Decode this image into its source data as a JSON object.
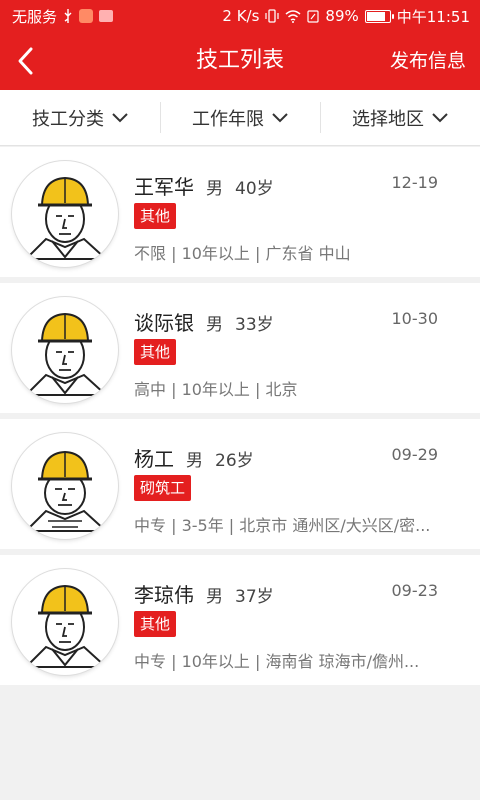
{
  "status_bar": {
    "carrier": "无服务",
    "speed": "2 K/s",
    "battery": "89%",
    "battery_level": 0.89,
    "time": "中午11:51"
  },
  "header": {
    "title": "技工列表",
    "action_label": "发布信息"
  },
  "filters": [
    {
      "label": "技工分类"
    },
    {
      "label": "工作年限"
    },
    {
      "label": "选择地区"
    }
  ],
  "workers": [
    {
      "name": "王军华",
      "gender": "男",
      "age": "40岁",
      "date": "12-19",
      "tag": "其他",
      "info": "不限 | 10年以上 | 广东省 中山"
    },
    {
      "name": "谈际银",
      "gender": "男",
      "age": "33岁",
      "date": "10-30",
      "tag": "其他",
      "info": "高中 | 10年以上 |  北京"
    },
    {
      "name": "杨工",
      "gender": "男",
      "age": "26岁",
      "date": "09-29",
      "tag": "砌筑工",
      "info": "中专 | 3-5年 | 北京市 通州区/大兴区/密..."
    },
    {
      "name": "李琼伟",
      "gender": "男",
      "age": "37岁",
      "date": "09-23",
      "tag": "其他",
      "info": "中专 | 10年以上 | 海南省 琼海市/儋州..."
    }
  ],
  "colors": {
    "brand": "#e41f1f",
    "helmet": "#f2c21b"
  }
}
